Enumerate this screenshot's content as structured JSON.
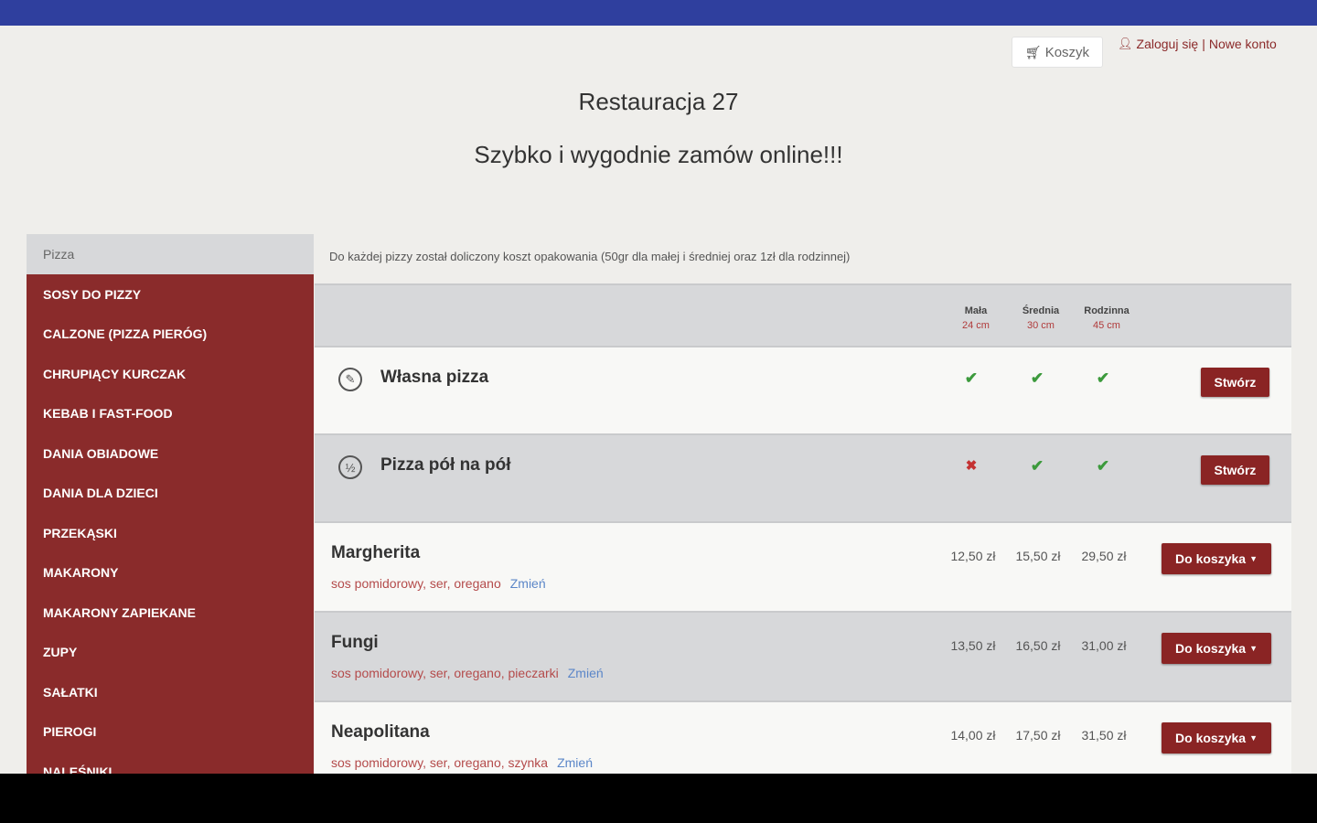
{
  "header": {
    "cart_label": "Koszyk",
    "login_label": "Zaloguj się",
    "separator": "|",
    "register_label": "Nowe konto"
  },
  "restaurant": {
    "title": "Restauracja 27",
    "subtitle": "Szybko i wygodnie zamów online!!!"
  },
  "sidebar": {
    "active": "Pizza",
    "items": [
      "SOSY DO PIZZY",
      "CALZONE (PIZZA PIERÓG)",
      "CHRUPIĄCY KURCZAK",
      "KEBAB I FAST-FOOD",
      "DANIA OBIADOWE",
      "DANIA DLA DZIECI",
      "PRZEKĄSKI",
      "MAKARONY",
      "MAKARONY ZAPIEKANE",
      "ZUPY",
      "SAŁATKI",
      "PIEROGI",
      "NALEŚNIKI"
    ]
  },
  "menu": {
    "notice": "Do każdej pizzy został doliczony koszt opakowania (50gr dla małej i średniej oraz 1zł dla rodzinnej)",
    "sizes": [
      {
        "name": "Mała",
        "dim": "24 cm"
      },
      {
        "name": "Średnia",
        "dim": "30 cm"
      },
      {
        "name": "Rodzinna",
        "dim": "45 cm"
      }
    ],
    "specials": [
      {
        "name": "Własna pizza",
        "icon": "pencil-icon",
        "glyph": "✎",
        "availability": [
          "✔",
          "✔",
          "✔"
        ],
        "button": "Stwórz"
      },
      {
        "name": "Pizza pół na pół",
        "icon": "half-half-icon",
        "glyph": "½",
        "availability": [
          "✖",
          "✔",
          "✔"
        ],
        "button": "Stwórz"
      }
    ],
    "pizzas": [
      {
        "name": "Margherita",
        "desc": "sos pomidorowy, ser, oregano",
        "change": "Zmień",
        "prices": [
          "12,50 zł",
          "15,50 zł",
          "29,50 zł"
        ],
        "button": "Do koszyka"
      },
      {
        "name": "Fungi",
        "desc": "sos pomidorowy, ser, oregano, pieczarki",
        "change": "Zmień",
        "prices": [
          "13,50 zł",
          "16,50 zł",
          "31,00 zł"
        ],
        "button": "Do koszyka"
      },
      {
        "name": "Neapolitana",
        "desc": "sos pomidorowy, ser, oregano, szynka",
        "change": "Zmień",
        "prices": [
          "14,00 zł",
          "17,50 zł",
          "31,50 zł"
        ],
        "button": "Do koszyka"
      }
    ]
  },
  "colors": {
    "topbar": "#2f3f9e",
    "sidebar": "#8a2b2b",
    "button": "#8a2424",
    "ok": "#3c9a3c",
    "no": "#c43232",
    "link": "#5b86c8"
  }
}
